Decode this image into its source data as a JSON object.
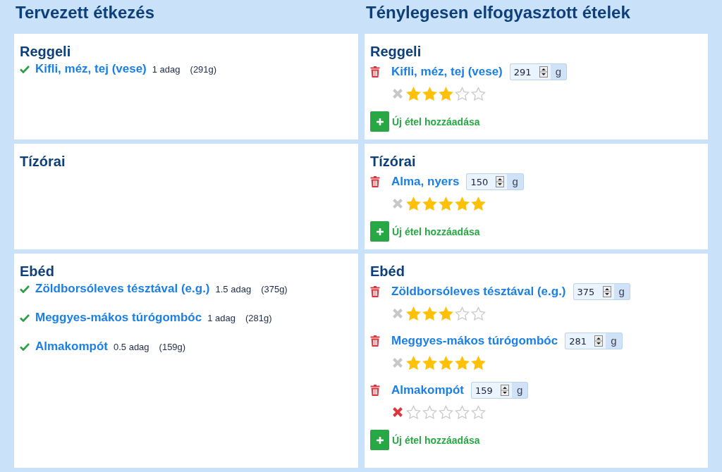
{
  "columns": {
    "planned_title": "Tervezett étkezés",
    "actual_title": "Ténylegesen elfogyasztott ételek"
  },
  "meals": [
    {
      "planned": {
        "title": "Reggeli",
        "items": [
          {
            "name": "Kifli, méz, tej (vese)",
            "checked": true,
            "portion": "1 adag",
            "weight": "(291g)"
          }
        ]
      },
      "actual": {
        "title": "Reggeli",
        "items": [
          {
            "name": "Kifli, méz, tej (vese)",
            "grams": "291",
            "unit": "g",
            "rejected": false,
            "stars": 3
          }
        ],
        "add_label": "Új étel hozzáadása"
      }
    },
    {
      "planned": {
        "title": "Tízórai"
      },
      "actual": {
        "title": "Tízórai",
        "items": [
          {
            "name": "Alma, nyers",
            "grams": "150",
            "unit": "g",
            "rejected": false,
            "stars": 5
          }
        ],
        "add_label": "Új étel hozzáadása"
      }
    },
    {
      "planned": {
        "title": "Ebéd",
        "items": [
          {
            "name": "Zöldborsóleves tésztával (e.g.)",
            "checked": true,
            "portion": "1.5 adag",
            "weight": "(375g)"
          },
          {
            "name": "Meggyes-mákos túrógombóc",
            "checked": true,
            "portion": "1 adag",
            "weight": "(281g)"
          },
          {
            "name": "Almakompót",
            "checked": true,
            "portion": "0.5 adag",
            "weight": "(159g)"
          }
        ]
      },
      "actual": {
        "title": "Ebéd",
        "items": [
          {
            "name": "Zöldborsóleves tésztával (e.g.)",
            "grams": "375",
            "unit": "g",
            "rejected": false,
            "stars": 3
          },
          {
            "name": "Meggyes-mákos túrógombóc",
            "grams": "281",
            "unit": "g",
            "rejected": false,
            "stars": 5
          },
          {
            "name": "Almakompót",
            "grams": "159",
            "unit": "g",
            "rejected": true,
            "stars": 0
          }
        ],
        "add_label": "Új étel hozzáadása"
      }
    }
  ]
}
